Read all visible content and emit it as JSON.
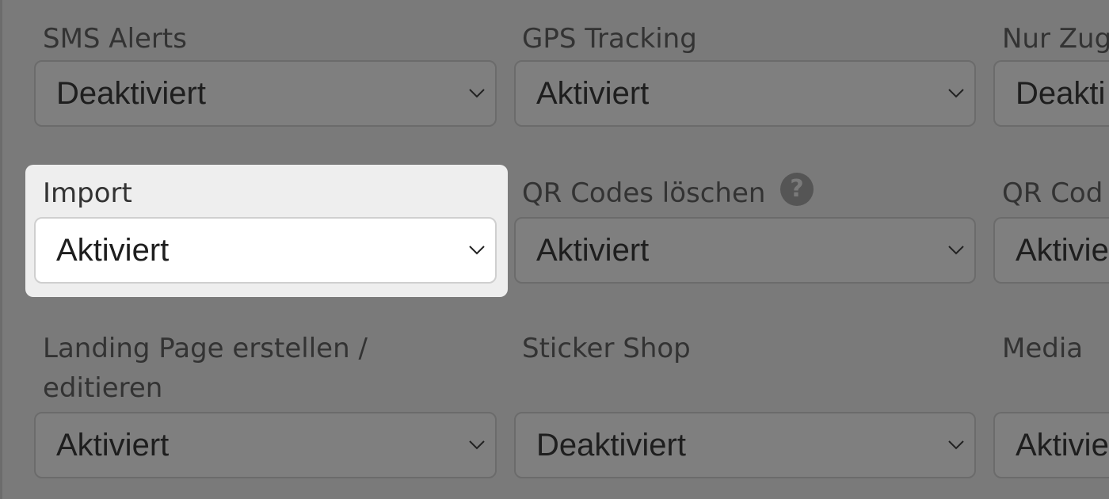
{
  "fields": {
    "sms_alerts": {
      "label": "SMS Alerts",
      "value": "Deaktiviert"
    },
    "gps_tracking": {
      "label": "GPS Tracking",
      "value": "Aktiviert"
    },
    "nur_zug": {
      "label": "Nur Zug",
      "value": "Deakti"
    },
    "import": {
      "label": "Import",
      "value": "Aktiviert"
    },
    "qr_codes_loeschen": {
      "label": "QR Codes löschen",
      "value": "Aktiviert"
    },
    "qr_cod": {
      "label": "QR Cod",
      "value": "Aktivie"
    },
    "landing_page": {
      "label": "Landing Page erstellen / editieren",
      "value": "Aktiviert"
    },
    "sticker_shop": {
      "label": "Sticker Shop",
      "value": "Deaktiviert"
    },
    "media": {
      "label": "Media",
      "value": "Aktivie"
    }
  },
  "help_icon_glyph": "?",
  "colors": {
    "overlay": "#7a7a7a",
    "highlight_panel": "#eeeeee",
    "help_icon": "#555555"
  }
}
